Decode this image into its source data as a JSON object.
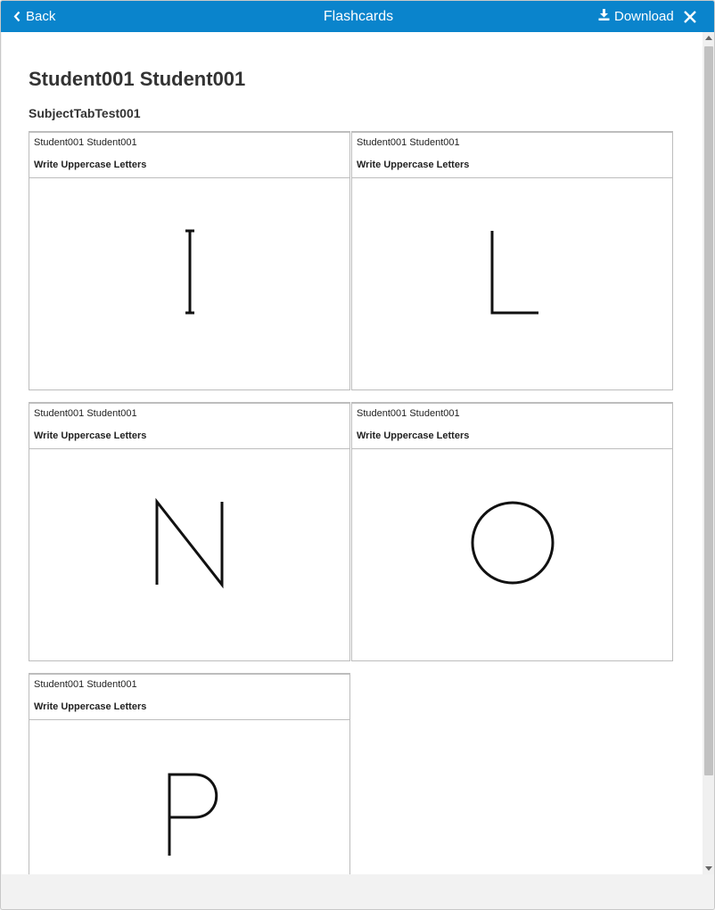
{
  "header": {
    "back_label": "Back",
    "title": "Flashcards",
    "download_label": "Download"
  },
  "page": {
    "student_name": "Student001 Student001",
    "subject": "SubjectTabTest001"
  },
  "cards": [
    {
      "student": "Student001 Student001",
      "task": "Write Uppercase Letters",
      "letter": "I"
    },
    {
      "student": "Student001 Student001",
      "task": "Write Uppercase Letters",
      "letter": "L"
    },
    {
      "student": "Student001 Student001",
      "task": "Write Uppercase Letters",
      "letter": "N"
    },
    {
      "student": "Student001 Student001",
      "task": "Write Uppercase Letters",
      "letter": "O"
    },
    {
      "student": "Student001 Student001",
      "task": "Write Uppercase Letters",
      "letter": "P"
    }
  ],
  "icons": {
    "back": "chevron-left-icon",
    "download": "download-icon",
    "close": "close-icon"
  },
  "colors": {
    "header_bg": "#0a84cc",
    "header_text": "#ffffff"
  }
}
